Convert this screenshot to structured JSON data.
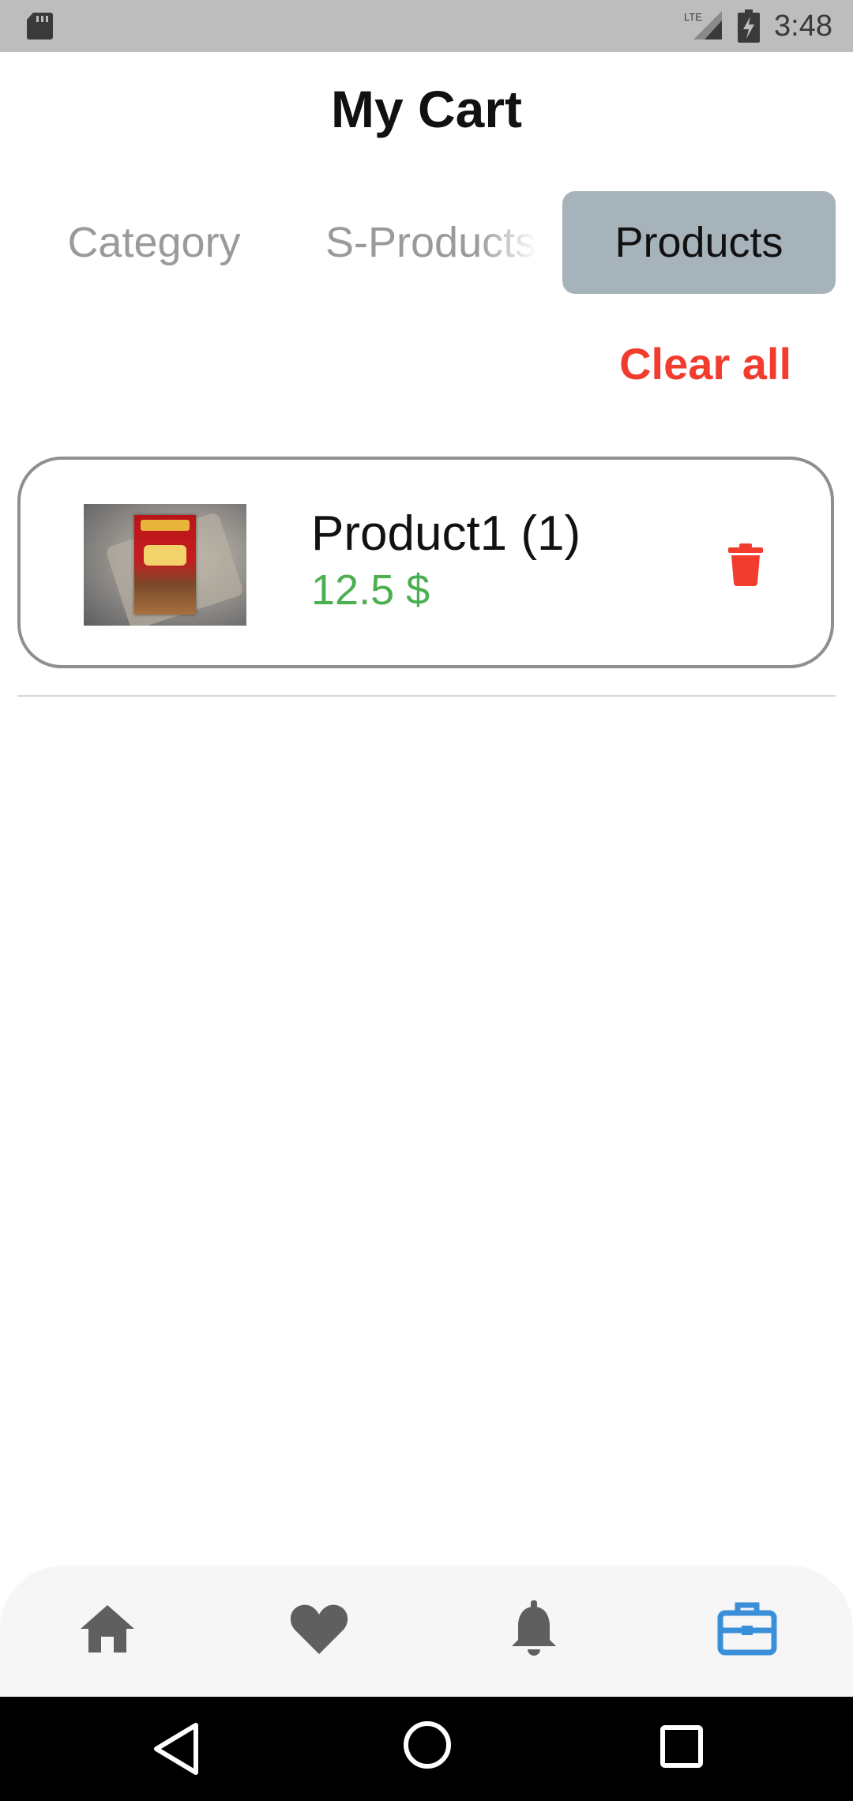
{
  "status_bar": {
    "time": "3:48",
    "network": "LTE",
    "icons": [
      "sd-card-icon",
      "lte-signal-icon",
      "battery-charging-icon"
    ]
  },
  "header": {
    "title": "My Cart"
  },
  "tabs": [
    {
      "label": "Category",
      "active": false
    },
    {
      "label": "S-Products",
      "active": false
    },
    {
      "label": "Products",
      "active": true
    }
  ],
  "actions": {
    "clear_all_label": "Clear all"
  },
  "cart_items": [
    {
      "name": "Product1 (1)",
      "price": "12.5 $",
      "thumbnail_icon": "product-photo",
      "delete_icon": "trash-icon"
    }
  ],
  "bottom_nav": [
    {
      "icon": "home-icon",
      "active": false
    },
    {
      "icon": "heart-icon",
      "active": false
    },
    {
      "icon": "bell-icon",
      "active": false
    },
    {
      "icon": "briefcase-icon",
      "active": true
    }
  ],
  "colors": {
    "accent_red": "#f23d2e",
    "price_green": "#4caf50",
    "active_tab_bg": "#a6b3ba",
    "active_nav": "#3a8fd8",
    "inactive_nav": "#5f5f5f"
  }
}
